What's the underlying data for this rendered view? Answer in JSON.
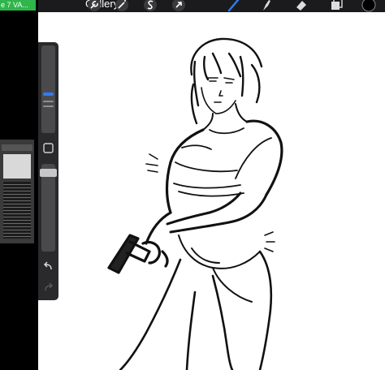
{
  "pip": {
    "label": "e 7 VA..."
  },
  "toolbar": {
    "gallery_label": "Gallery",
    "icons": {
      "actions": "wrench-icon",
      "adjustments": "magic-wand-icon",
      "selection": "selection-s-icon",
      "transform": "arrow-cursor-icon",
      "brush": "brush-icon",
      "smudge": "smudge-finger-icon",
      "eraser": "eraser-icon",
      "layers": "layers-icon",
      "color": "color-swatch-icon"
    },
    "accent_color": "#2f7cf6",
    "active_tool": "brush"
  },
  "sidebar": {
    "icons": {
      "modify": "square-modify-icon",
      "undo": "undo-arrow-icon",
      "redo": "redo-arrow-icon"
    }
  },
  "colors": {
    "current_color": "#000000",
    "canvas": "#ffffff"
  }
}
